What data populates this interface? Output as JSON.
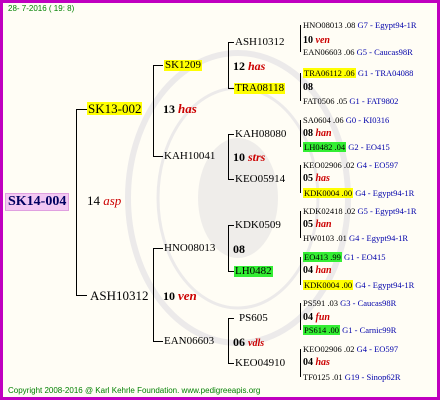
{
  "date": "28- 7-2016 ( 19: 8)",
  "copyright": "Copyright 2008-2016 @ Karl Kehrle Foundation.   www.pedigreeapis.org",
  "root": {
    "id": "SK14-004",
    "num": "14",
    "species": "asp"
  },
  "gen1": [
    {
      "id": "SK13-002",
      "num": "13",
      "species": "has"
    },
    {
      "id": "ASH10312",
      "num": "10",
      "species": "ven"
    }
  ],
  "gen2": [
    {
      "id": "SK1209",
      "num": "12",
      "species": "has"
    },
    {
      "id": "KAH10041",
      "num": "10",
      "species": "strs"
    },
    {
      "id": "HNO08013",
      "num": "08",
      "species": ""
    },
    {
      "id": "EAN06603",
      "num": "06",
      "species": "vdls"
    }
  ],
  "gen3": [
    {
      "id": "ASH10312",
      "num": "10",
      "species": "ven"
    },
    {
      "id": "TRA08118",
      "num": "08",
      "species": ""
    },
    {
      "id": "KAH08080",
      "num": "08",
      "species": "han"
    },
    {
      "id": "KEO05914",
      "num": "05",
      "species": "has"
    },
    {
      "id": "KDK0509",
      "num": "05",
      "species": "han"
    },
    {
      "id": "LH0482",
      "num": "04",
      "species": "han"
    },
    {
      "id": "PS605",
      "num": "04",
      "species": "fun"
    },
    {
      "id": "KEO04910",
      "num": "04",
      "species": "has"
    }
  ],
  "gen4": [
    {
      "left": "HNO08013 .08",
      "right": "G7 - Egypt94-1R"
    },
    {
      "left": "EAN06603 .06",
      "right": "G5 - Caucas98R"
    },
    {
      "left": "TRA06112 .06",
      "right": "G1 - TRA04088"
    },
    {
      "left": "FAT0506 .05",
      "right": "G1 - FAT9802"
    },
    {
      "left": "SA0604 .06",
      "right": "G0 - KI0316"
    },
    {
      "left": "LH0482 .04",
      "right": "G2 - EO415"
    },
    {
      "left": "KEO02906 .02",
      "right": "G4 - EO597"
    },
    {
      "left": "KDK0004 .00",
      "right": "G4 - Egypt94-1R"
    },
    {
      "left": "KDK02418 .02",
      "right": "G5 - Egypt94-1R"
    },
    {
      "left": "HW0103 .01",
      "right": "G4 - Egypt94-1R"
    },
    {
      "left": "EO413 .99",
      "right": "G1 - EO415"
    },
    {
      "left": "KDK0004 .00",
      "right": "G4 - Egypt94-1R"
    },
    {
      "left": "PS591 .03",
      "right": "G3 - Caucas98R"
    },
    {
      "left": "PS614 .00",
      "right": "G1 - Carnic99R"
    },
    {
      "left": "KEO02906 .02",
      "right": "G4 - EO597"
    },
    {
      "left": "TF0125 .01",
      "right": "G19 - Sinop62R"
    }
  ],
  "colors": {
    "border": "#c000c0",
    "species": "#cc0000",
    "info": "#0000aa",
    "highlight_yellow": "#ffff00",
    "highlight_green": "#33ee33",
    "footer": "#008000"
  }
}
